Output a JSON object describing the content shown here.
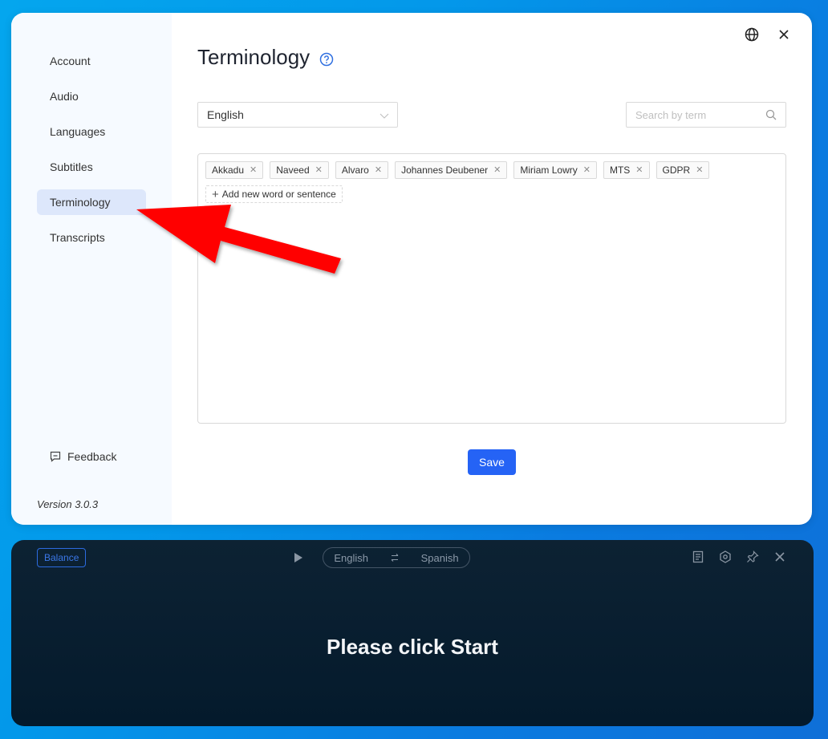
{
  "sidebar": {
    "items": [
      {
        "label": "Account",
        "active": false
      },
      {
        "label": "Audio",
        "active": false
      },
      {
        "label": "Languages",
        "active": false
      },
      {
        "label": "Subtitles",
        "active": false
      },
      {
        "label": "Terminology",
        "active": true
      },
      {
        "label": "Transcripts",
        "active": false
      }
    ],
    "feedback_label": "Feedback",
    "version": "Version 3.0.3"
  },
  "main": {
    "title": "Terminology",
    "language_select": {
      "value": "English"
    },
    "search": {
      "placeholder": "Search by term",
      "value": ""
    },
    "terms": [
      "Akkadu",
      "Naveed",
      "Alvaro",
      "Johannes Deubener",
      "Miriam Lowry",
      "MTS",
      "GDPR"
    ],
    "add_term_label": "Add new word or sentence",
    "save_label": "Save"
  },
  "player": {
    "balance_label": "Balance",
    "source_language": "English",
    "target_language": "Spanish",
    "status_message": "Please click Start"
  },
  "colors": {
    "accent": "#2563f5",
    "annotation_arrow": "#ff0000",
    "player_bg": "#041a2c"
  }
}
